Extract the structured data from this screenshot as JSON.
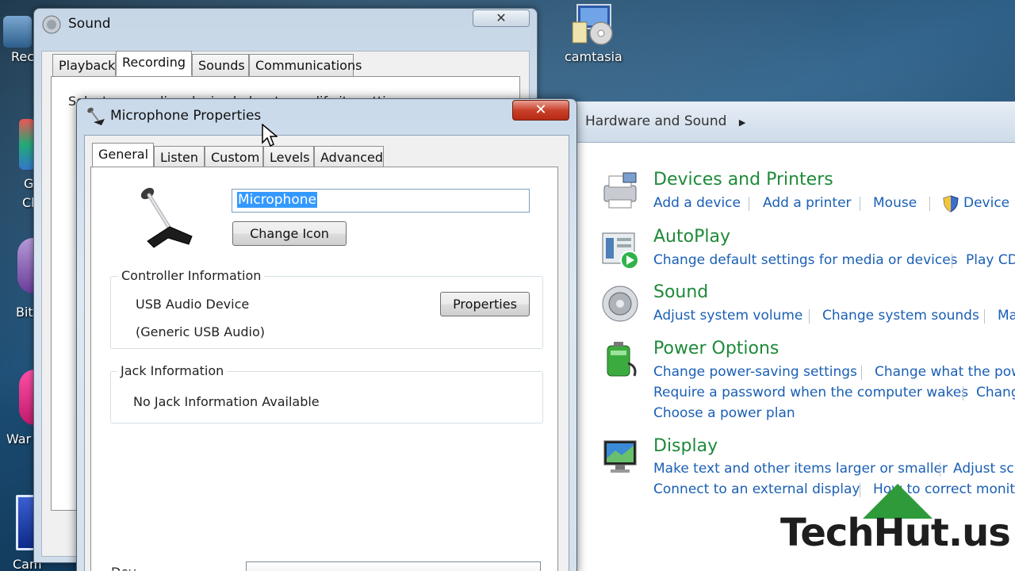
{
  "desktop": {
    "left_labels": [
      "Rec",
      "G",
      "Cl",
      "Bit",
      "War",
      "Cam"
    ],
    "camtasia_label": "camtasia"
  },
  "sound_window": {
    "title": "Sound",
    "close_glyph": "✕",
    "tabs": [
      "Playback",
      "Recording",
      "Sounds",
      "Communications"
    ],
    "active_tab": "Recording",
    "description": "Select a recording device below to modify its settings:"
  },
  "control_panel": {
    "breadcrumb": "Hardware and Sound",
    "breadcrumb_arrow": "▶",
    "categories": [
      {
        "title": "Devices and Printers",
        "icon": "printer-icon",
        "links": [
          "Add a device",
          "Add a printer",
          "Mouse",
          "Device M"
        ]
      },
      {
        "title": "AutoPlay",
        "icon": "autoplay-icon",
        "links": [
          "Change default settings for media or devices",
          "Play CD"
        ]
      },
      {
        "title": "Sound",
        "icon": "speaker-icon",
        "links": [
          "Adjust system volume",
          "Change system sounds",
          "Ma"
        ]
      },
      {
        "title": "Power Options",
        "icon": "battery-icon",
        "links": [
          "Change power-saving settings",
          "Change what the pow",
          "Require a password when the computer wakes",
          "Chang",
          "Choose a power plan"
        ]
      },
      {
        "title": "Display",
        "icon": "monitor-icon",
        "links": [
          "Make text and other items larger or smaller",
          "Adjust scr",
          "Connect to an external display",
          "How to correct monito"
        ]
      }
    ]
  },
  "mic_dialog": {
    "title": "Microphone Properties",
    "close_glyph": "✕",
    "tabs": [
      "General",
      "Listen",
      "Custom",
      "Levels",
      "Advanced"
    ],
    "active_tab": "General",
    "name_value": "Microphone",
    "change_icon_label": "Change Icon",
    "controller_legend": "Controller Information",
    "controller_name": "USB Audio Device",
    "controller_sub": "(Generic USB Audio)",
    "properties_label": "Properties",
    "jack_legend": "Jack Information",
    "jack_text": "No Jack Information Available",
    "bottom_label": "Dev"
  },
  "watermark": {
    "text": "TechHut.us"
  },
  "colors": {
    "cp_title": "#1e8a3a",
    "cp_link": "#1a5fb4",
    "close_red": "#c9412b",
    "selection": "#3399ff"
  }
}
